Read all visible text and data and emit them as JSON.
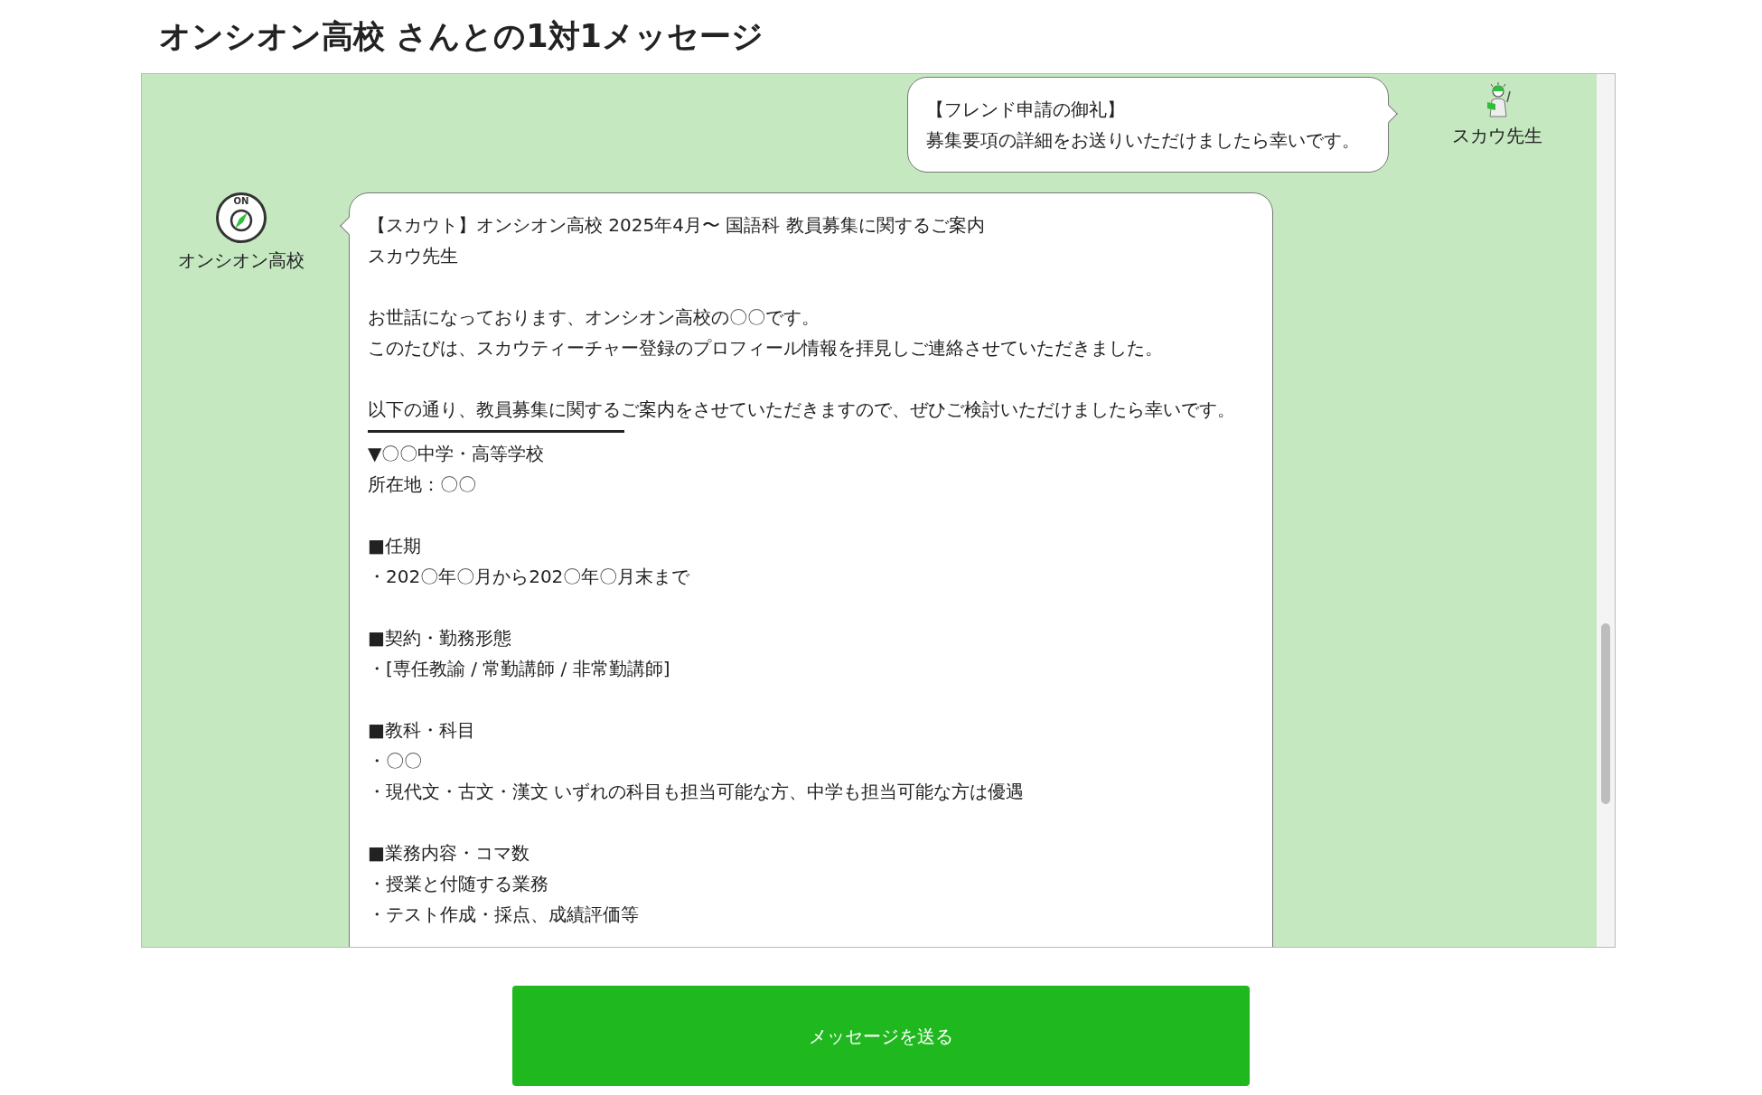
{
  "title": "オンシオン高校 さんとの1対1メッセージ",
  "messages": [
    {
      "kind": "sent",
      "sender": "スカウ先生",
      "blocks": [
        {
          "kind": "paragraph",
          "lines": [
            "【フレンド申請の御礼】",
            "募集要項の詳細をお送りいただけましたら幸いです。"
          ]
        }
      ]
    },
    {
      "kind": "received",
      "sender": "オンシオン高校",
      "logo_text": "ON",
      "blocks": [
        {
          "kind": "paragraph",
          "lines": [
            "【スカウト】オンシオン高校 2025年4月〜 国語科 教員募集に関するご案内",
            "スカウ先生"
          ]
        },
        {
          "kind": "paragraph",
          "lines": [
            "お世話になっております、オンシオン高校の〇〇です。",
            "このたびは、スカウティーチャー登録のプロフィール情報を拝見しご連絡させていただきました。"
          ]
        },
        {
          "kind": "paragraph",
          "lines": [
            "以下の通り、教員募集に関するご案内をさせていただきますので、ぜひご検討いただけましたら幸いです。"
          ]
        },
        {
          "kind": "rule"
        },
        {
          "kind": "paragraph",
          "lines": [
            "▼〇〇中学・高等学校",
            "所在地：〇〇"
          ]
        },
        {
          "kind": "paragraph",
          "lines": [
            "■任期",
            "・202〇年〇月から202〇年〇月末まで"
          ]
        },
        {
          "kind": "paragraph",
          "lines": [
            "■契約・勤務形態",
            "・[専任教諭 / 常勤講師 / 非常勤講師]"
          ]
        },
        {
          "kind": "paragraph",
          "lines": [
            "■教科・科目",
            "・〇〇",
            "・現代文・古文・漢文 いずれの科目も担当可能な方、中学も担当可能な方は優遇"
          ]
        },
        {
          "kind": "paragraph",
          "lines": [
            "■業務内容・コマ数",
            "・授業と付随する業務",
            "・テスト作成・採点、成績評価等"
          ]
        }
      ]
    }
  ],
  "send_button": "メッセージを送る"
}
